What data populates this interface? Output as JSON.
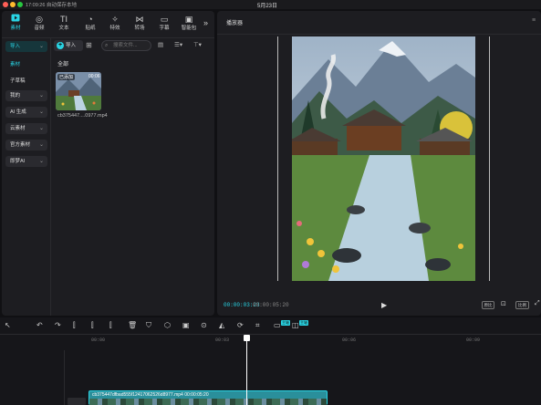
{
  "titlebar": {
    "left_text": "17:09:26 自动保存本地",
    "center_text": "5月23日",
    "colors": {
      "close": "#ff5f57",
      "minimize": "#febc2e",
      "zoom": "#28c840"
    }
  },
  "toolbar": {
    "items": [
      {
        "label": "素材",
        "icon": "media-icon"
      },
      {
        "label": "音频",
        "icon": "audio-icon"
      },
      {
        "label": "文本",
        "icon": "text-icon"
      },
      {
        "label": "贴纸",
        "icon": "sticker-icon"
      },
      {
        "label": "特效",
        "icon": "effects-icon"
      },
      {
        "label": "转场",
        "icon": "transition-icon"
      },
      {
        "label": "字幕",
        "icon": "caption-icon"
      },
      {
        "label": "智能包",
        "icon": "smart-pack-icon"
      }
    ],
    "more": "»"
  },
  "sidebar": {
    "import_label": "导入",
    "items": [
      {
        "label": "素材",
        "type": "plain",
        "active": true
      },
      {
        "label": "子草稿",
        "type": "plain"
      },
      {
        "label": "我的",
        "type": "pill"
      },
      {
        "label": "AI 生成",
        "type": "pill"
      },
      {
        "label": "云素材",
        "type": "pill"
      },
      {
        "label": "官方素材",
        "type": "pill"
      },
      {
        "label": "即梦AI",
        "type": "pill"
      }
    ]
  },
  "library": {
    "import_button": "导入",
    "search_placeholder": "搜索文件...",
    "section_all": "全部",
    "thumb": {
      "added_badge": "已添加",
      "duration": "00:06",
      "filename": "cb375447....0977.mp4"
    }
  },
  "player": {
    "title": "播放器",
    "time_current": "00:00:03:23",
    "time_total": "00:00:05:20",
    "ratio_label": "原比",
    "aspect_label": "比例",
    "accent": "#29d4e4"
  },
  "timeline": {
    "ticks": [
      "00:00",
      "00:03",
      "00:06",
      "00:09"
    ],
    "clip_label": "cb375447dfbad555f12417062526d8977.mp4  00:00:05:20",
    "tag1": "主轴",
    "tag2": "主轴"
  }
}
